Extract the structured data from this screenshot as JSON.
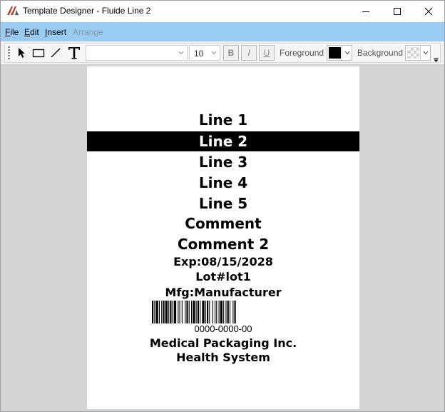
{
  "window": {
    "title": "Template Designer - Fluide Line 2",
    "controls": [
      "minimize-icon",
      "maximize-icon",
      "close-icon"
    ]
  },
  "menu": {
    "items": [
      {
        "label": "File",
        "enabled": true
      },
      {
        "label": "Edit",
        "enabled": true
      },
      {
        "label": "Insert",
        "enabled": true
      },
      {
        "label": "Arrange",
        "enabled": false
      }
    ]
  },
  "toolbar": {
    "tools": [
      "pointer-icon",
      "rectangle-icon",
      "line-icon",
      "text-icon"
    ],
    "font_name": "",
    "font_size": "10",
    "bold": "B",
    "italic": "I",
    "underline": "U",
    "foreground_label": "Foreground",
    "foreground_color": "#000000",
    "background_label": "Background",
    "background_color": "transparent"
  },
  "label": {
    "lines": [
      "Line 1",
      "Line 2",
      "Line 3",
      "Line 4",
      "Line 5",
      "Comment",
      "Comment 2"
    ],
    "selected_line": "Line 2",
    "exp": "Exp:08/15/2028",
    "lot": "Lot#lot1",
    "mfg": "Mfg:Manufacturer",
    "barcode_number": "0000-0000-00",
    "company": "Medical Packaging Inc.",
    "system": "Health System"
  }
}
